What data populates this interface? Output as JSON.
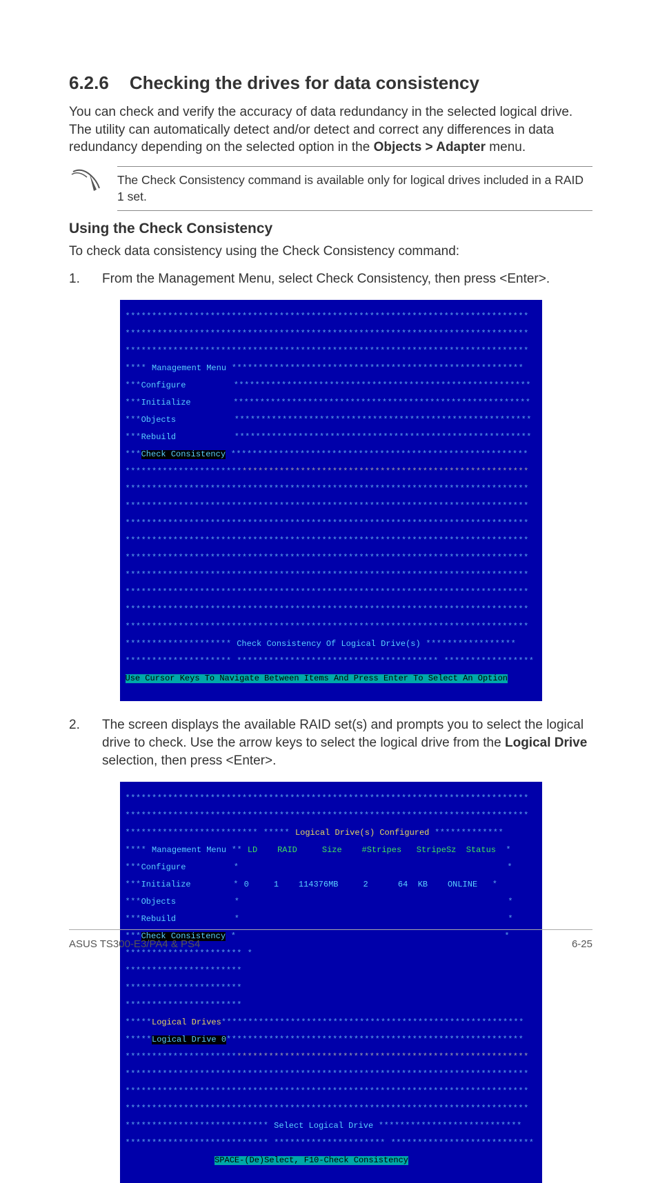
{
  "section": {
    "number": "6.2.6",
    "title": "Checking the drives for data consistency"
  },
  "intro": {
    "part1": "You can check and verify the accuracy of data redundancy in the selected logical drive. The utility can automatically detect and/or detect and correct any differences in data redundancy depending on the selected option in the ",
    "bold": "Objects > Adapter",
    "part2": " menu."
  },
  "note": "The Check Consistency command is available only for logical drives included in a RAID 1 set.",
  "subheading": "Using the Check Consistency",
  "subheading_intro": "To check data consistency using the Check Consistency command:",
  "steps": {
    "1": {
      "num": "1.",
      "text": "From the Management Menu, select Check Consistency, then press <Enter>."
    },
    "2": {
      "num": "2.",
      "part1": "The screen displays the available RAID set(s) and prompts you to select the logical drive to check. Use the arrow keys to select the logical drive from the ",
      "bold": "Logical Drive",
      "part2": " selection, then press <Enter>."
    }
  },
  "bios1": {
    "menu_title": "Management Menu",
    "items": [
      "Configure",
      "Initialize",
      "Objects",
      "Rebuild",
      "Check Consistency"
    ],
    "prompt": "Check Consistency Of Logical Drive(s)",
    "hint": "Use Cursor Keys To Navigate Between Items And Press Enter To Select An Option"
  },
  "bios2": {
    "menu_title": "Management Menu",
    "items": [
      "Configure",
      "Initialize",
      "Objects",
      "Rebuild",
      "Check Consistency"
    ],
    "header_title": "Logical Drive(s) Configured",
    "columns": [
      "LD",
      "RAID",
      "Size",
      "#Stripes",
      "StripeSz",
      "Status"
    ],
    "row": {
      "ld": "0",
      "raid": "1",
      "size": "114376MB",
      "stripes": "2",
      "stripesz": "64  KB",
      "status": "ONLINE"
    },
    "logical_drives": "Logical Drives",
    "logical_drive_sel": "Logical Drive 0",
    "prompt": "Select Logical Drive",
    "hint": "SPACE-(De)Select, F10-Check Consistency"
  },
  "footer": {
    "left": "ASUS TS300-E3/PA4 & PS4",
    "right": "6-25"
  }
}
